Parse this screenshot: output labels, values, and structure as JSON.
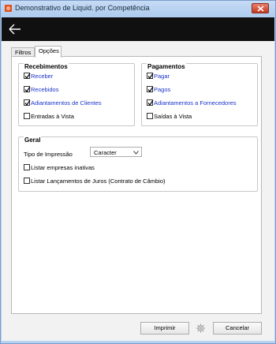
{
  "window": {
    "title": "Demonstrativo de  Liquid. por Competência",
    "close_icon": "close-icon",
    "back_icon": "arrow-left-icon"
  },
  "tabs": [
    {
      "label": "Filtros",
      "active": false
    },
    {
      "label": "Opções",
      "active": true
    }
  ],
  "recebimentos": {
    "title": "Recebimentos",
    "items": [
      {
        "label": "Receber",
        "checked": true
      },
      {
        "label": "Recebidos",
        "checked": true
      },
      {
        "label": "Adiantamentos de Clientes",
        "checked": true
      },
      {
        "label": "Entradas à Vista",
        "checked": false
      }
    ]
  },
  "pagamentos": {
    "title": "Pagamentos",
    "items": [
      {
        "label": "Pagar",
        "checked": true
      },
      {
        "label": "Pagos",
        "checked": true
      },
      {
        "label": "Adiantamentos a Fornecedores",
        "checked": true
      },
      {
        "label": "Saídas à Vista",
        "checked": false
      }
    ]
  },
  "geral": {
    "title": "Geral",
    "tipo_impressao_label": "Tipo de Impressão",
    "tipo_impressao_value": "Caracter",
    "options": [
      {
        "label": "Listar empresas inativas",
        "checked": false
      },
      {
        "label": "Listar Lançamentos de Juros (Contrato de Câmbio)",
        "checked": false
      }
    ]
  },
  "footer": {
    "imprimir_label": "Imprimir",
    "cancelar_label": "Cancelar",
    "gear_icon": "gear-icon"
  },
  "colors": {
    "header_bg": "#101010",
    "link_text": "#1a34c8",
    "window_frame": "#b8d2f2"
  }
}
